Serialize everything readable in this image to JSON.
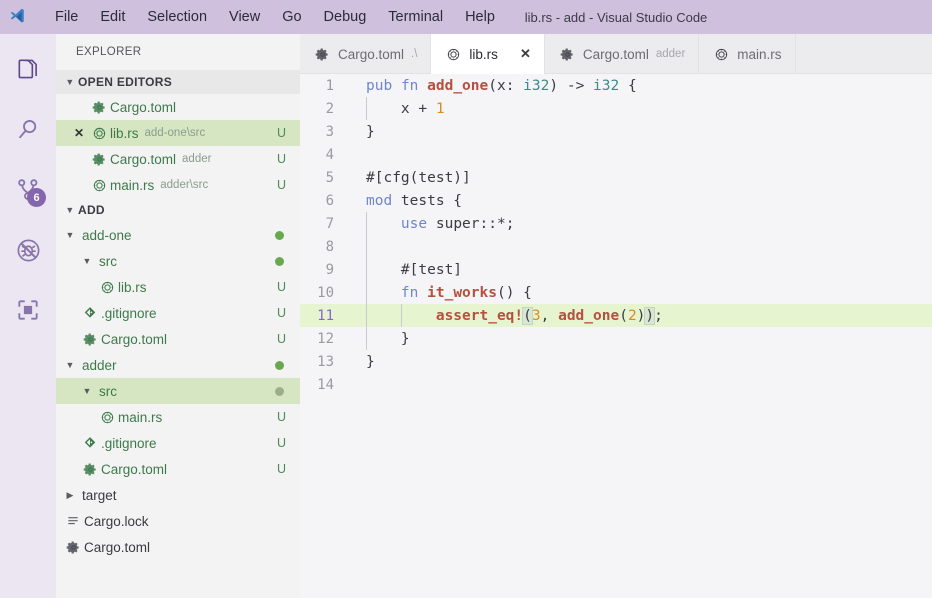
{
  "titlebar": {
    "logo_icon": "vscode-logo-icon",
    "window_title": "lib.rs - add - Visual Studio Code",
    "menus": [
      {
        "label": "File"
      },
      {
        "label": "Edit"
      },
      {
        "label": "Selection"
      },
      {
        "label": "View"
      },
      {
        "label": "Go"
      },
      {
        "label": "Debug"
      },
      {
        "label": "Terminal"
      },
      {
        "label": "Help"
      }
    ]
  },
  "activitybar": {
    "items": [
      {
        "name": "explorer",
        "icon": "files-icon",
        "active": true,
        "badge": ""
      },
      {
        "name": "search",
        "icon": "search-icon",
        "active": false,
        "badge": ""
      },
      {
        "name": "source-control",
        "icon": "source-control-icon",
        "active": false,
        "badge": "6"
      },
      {
        "name": "debug",
        "icon": "debug-icon",
        "active": false,
        "badge": ""
      },
      {
        "name": "extensions",
        "icon": "extensions-icon",
        "active": false,
        "badge": ""
      }
    ]
  },
  "sidebar": {
    "title": "EXPLORER",
    "sections": [
      {
        "label": "OPEN EDITORS",
        "expanded": true
      },
      {
        "label": "ADD",
        "expanded": true
      }
    ],
    "open_editors": [
      {
        "label": "Cargo.toml",
        "desc": "",
        "icon": "toml-gear-icon",
        "status": "",
        "indent": 1,
        "closable": false,
        "selected": false
      },
      {
        "label": "lib.rs",
        "desc": "add-one\\src",
        "icon": "rust-icon",
        "status": "U",
        "indent": 1,
        "closable": true,
        "selected": true
      },
      {
        "label": "Cargo.toml",
        "desc": "adder",
        "icon": "toml-gear-icon",
        "status": "U",
        "indent": 1,
        "closable": false,
        "selected": false
      },
      {
        "label": "main.rs",
        "desc": "adder\\src",
        "icon": "rust-icon",
        "status": "U",
        "indent": 1,
        "closable": false,
        "selected": false
      }
    ],
    "tree": [
      {
        "label": "add-one",
        "icon": "folder-open-icon",
        "status": "",
        "dot": "green",
        "indent": 1,
        "kind": "folder",
        "expanded": true,
        "modified": true,
        "selected": false
      },
      {
        "label": "src",
        "icon": "folder-open-icon",
        "status": "",
        "dot": "green",
        "indent": 2,
        "kind": "folder",
        "expanded": true,
        "modified": true,
        "selected": false
      },
      {
        "label": "lib.rs",
        "icon": "rust-icon",
        "status": "U",
        "dot": "",
        "indent": 3,
        "kind": "file",
        "modified": true,
        "selected": false
      },
      {
        "label": ".gitignore",
        "icon": "git-icon",
        "status": "U",
        "dot": "",
        "indent": 2,
        "kind": "file",
        "modified": true,
        "selected": false
      },
      {
        "label": "Cargo.toml",
        "icon": "toml-gear-icon",
        "status": "U",
        "dot": "",
        "indent": 2,
        "kind": "file",
        "modified": true,
        "selected": false
      },
      {
        "label": "adder",
        "icon": "folder-open-icon",
        "status": "",
        "dot": "green",
        "indent": 1,
        "kind": "folder",
        "expanded": true,
        "modified": true,
        "selected": false
      },
      {
        "label": "src",
        "icon": "folder-open-icon",
        "status": "",
        "dot": "muted",
        "indent": 2,
        "kind": "folder",
        "expanded": true,
        "modified": true,
        "selected": true
      },
      {
        "label": "main.rs",
        "icon": "rust-icon",
        "status": "U",
        "dot": "",
        "indent": 3,
        "kind": "file",
        "modified": true,
        "selected": false
      },
      {
        "label": ".gitignore",
        "icon": "git-icon",
        "status": "U",
        "dot": "",
        "indent": 2,
        "kind": "file",
        "modified": true,
        "selected": false
      },
      {
        "label": "Cargo.toml",
        "icon": "toml-gear-icon",
        "status": "U",
        "dot": "",
        "indent": 2,
        "kind": "file",
        "modified": true,
        "selected": false
      },
      {
        "label": "target",
        "icon": "folder-closed-icon",
        "status": "",
        "dot": "",
        "indent": 1,
        "kind": "folder",
        "expanded": false,
        "modified": false,
        "selected": false
      },
      {
        "label": "Cargo.lock",
        "icon": "lock-list-icon",
        "status": "",
        "dot": "",
        "indent": 1,
        "kind": "file",
        "modified": false,
        "selected": false
      },
      {
        "label": "Cargo.toml",
        "icon": "toml-gear-icon",
        "status": "",
        "dot": "",
        "indent": 1,
        "kind": "file",
        "modified": false,
        "selected": false
      }
    ]
  },
  "tabs": [
    {
      "label": "Cargo.toml",
      "desc": ".\\",
      "icon": "toml-gear-icon",
      "active": false,
      "closable": false
    },
    {
      "label": "lib.rs",
      "desc": "",
      "icon": "rust-icon",
      "active": true,
      "closable": true,
      "close_glyph": "✕"
    },
    {
      "label": "Cargo.toml",
      "desc": "adder",
      "icon": "toml-gear-icon",
      "active": false,
      "closable": false
    },
    {
      "label": "main.rs",
      "desc": "",
      "icon": "rust-icon",
      "active": false,
      "closable": false
    }
  ],
  "editor": {
    "active_line": 11,
    "lines": [
      {
        "n": "1",
        "indent_guides": 0,
        "tokens": [
          {
            "t": "pub",
            "c": "kw"
          },
          {
            "t": " ",
            "c": "plainc"
          },
          {
            "t": "fn",
            "c": "kw"
          },
          {
            "t": " ",
            "c": "plainc"
          },
          {
            "t": "add_one",
            "c": "fnname"
          },
          {
            "t": "(x: ",
            "c": "punct"
          },
          {
            "t": "i32",
            "c": "type"
          },
          {
            "t": ") -> ",
            "c": "punct"
          },
          {
            "t": "i32",
            "c": "type"
          },
          {
            "t": " {",
            "c": "punct"
          }
        ]
      },
      {
        "n": "2",
        "indent_guides": 1,
        "tokens": [
          {
            "t": "    x + ",
            "c": "plainc"
          },
          {
            "t": "1",
            "c": "num"
          }
        ]
      },
      {
        "n": "3",
        "indent_guides": 0,
        "tokens": [
          {
            "t": "}",
            "c": "punct"
          }
        ]
      },
      {
        "n": "4",
        "indent_guides": 0,
        "tokens": [
          {
            "t": "",
            "c": "plainc"
          }
        ]
      },
      {
        "n": "5",
        "indent_guides": 0,
        "tokens": [
          {
            "t": "#[cfg(test)]",
            "c": "plainc"
          }
        ]
      },
      {
        "n": "6",
        "indent_guides": 0,
        "tokens": [
          {
            "t": "mod",
            "c": "kw"
          },
          {
            "t": " tests {",
            "c": "plainc"
          }
        ]
      },
      {
        "n": "7",
        "indent_guides": 1,
        "tokens": [
          {
            "t": "    ",
            "c": "plainc"
          },
          {
            "t": "use",
            "c": "kw"
          },
          {
            "t": " super::*;",
            "c": "plainc"
          }
        ]
      },
      {
        "n": "8",
        "indent_guides": 1,
        "tokens": [
          {
            "t": "",
            "c": "plainc"
          }
        ]
      },
      {
        "n": "9",
        "indent_guides": 1,
        "tokens": [
          {
            "t": "    #[test]",
            "c": "plainc"
          }
        ]
      },
      {
        "n": "10",
        "indent_guides": 1,
        "tokens": [
          {
            "t": "    ",
            "c": "plainc"
          },
          {
            "t": "fn",
            "c": "kw"
          },
          {
            "t": " ",
            "c": "plainc"
          },
          {
            "t": "it_works",
            "c": "fnname"
          },
          {
            "t": "() {",
            "c": "punct"
          }
        ]
      },
      {
        "n": "11",
        "indent_guides": 2,
        "current": true,
        "tokens": [
          {
            "t": "        ",
            "c": "plainc"
          },
          {
            "t": "assert_eq!",
            "c": "mac"
          },
          {
            "t": "(",
            "c": "brk"
          },
          {
            "t": "3",
            "c": "num"
          },
          {
            "t": ", ",
            "c": "punct"
          },
          {
            "t": "add_one",
            "c": "fnname"
          },
          {
            "t": "(",
            "c": "punct"
          },
          {
            "t": "2",
            "c": "num"
          },
          {
            "t": ")",
            "c": "punct"
          },
          {
            "t": ")",
            "c": "brk"
          },
          {
            "t": ";",
            "c": "punct"
          }
        ]
      },
      {
        "n": "12",
        "indent_guides": 1,
        "tokens": [
          {
            "t": "    }",
            "c": "punct"
          }
        ]
      },
      {
        "n": "13",
        "indent_guides": 0,
        "tokens": [
          {
            "t": "}",
            "c": "punct"
          }
        ]
      },
      {
        "n": "14",
        "indent_guides": 0,
        "tokens": [
          {
            "t": "",
            "c": "plainc"
          }
        ]
      }
    ]
  },
  "colors": {
    "titlebar_bg": "#cfc1dd",
    "activitybar_bg": "#ece6f2",
    "sidebar_bg": "#f3f3f3",
    "editor_bg": "#f5f4f7",
    "tab_active_bg": "#ffffff",
    "current_line_bg": "#e6f5d0",
    "selection_green": "#d7e6c2",
    "git_modified_text": "#3d7a4b",
    "badge_bg": "#68439a"
  }
}
